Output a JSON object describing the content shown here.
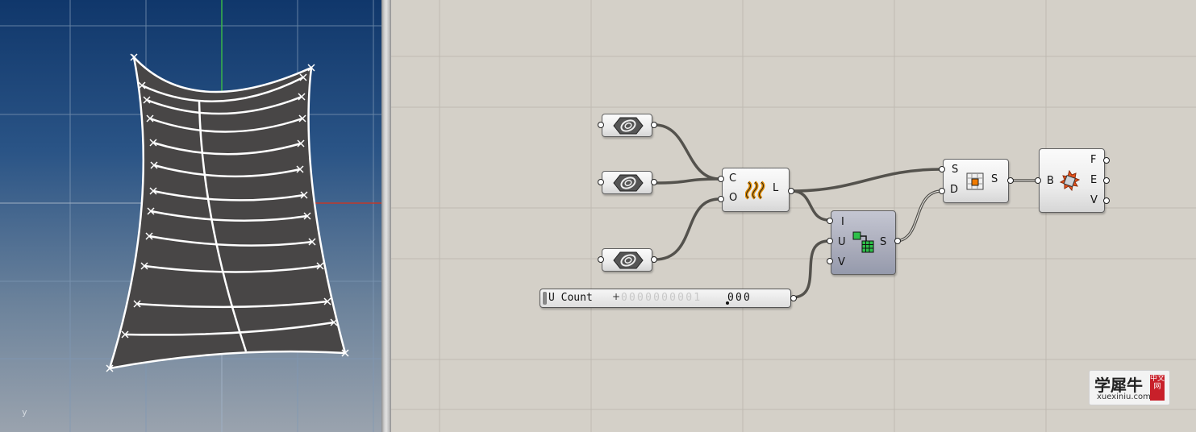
{
  "viewport": {
    "axis_label": "y"
  },
  "components": {
    "param1": {
      "name": "param-geometry-1"
    },
    "param2": {
      "name": "param-geometry-2"
    },
    "param3": {
      "name": "param-geometry-3"
    },
    "loft": {
      "inputs": [
        "C",
        "O"
      ],
      "outputs": [
        "L"
      ]
    },
    "divide": {
      "inputs": [
        "I",
        "U",
        "V"
      ],
      "outputs": [
        "S"
      ]
    },
    "split": {
      "inputs": [
        "S",
        "D"
      ],
      "outputs": [
        "S"
      ]
    },
    "explode": {
      "inputs": [
        "B"
      ],
      "outputs": [
        "F",
        "E",
        "V"
      ]
    }
  },
  "slider": {
    "label": "U Count",
    "plus": "+",
    "ghost_digits": "0000000001",
    "value": "000"
  },
  "watermark": {
    "cn": "学犀牛",
    "url": "xuexiniu.com",
    "badge": "中文网"
  },
  "colors": {
    "wire": "#54524d",
    "grid": "#bfbab2",
    "surface": "#484646",
    "curves": "#ffffff"
  }
}
